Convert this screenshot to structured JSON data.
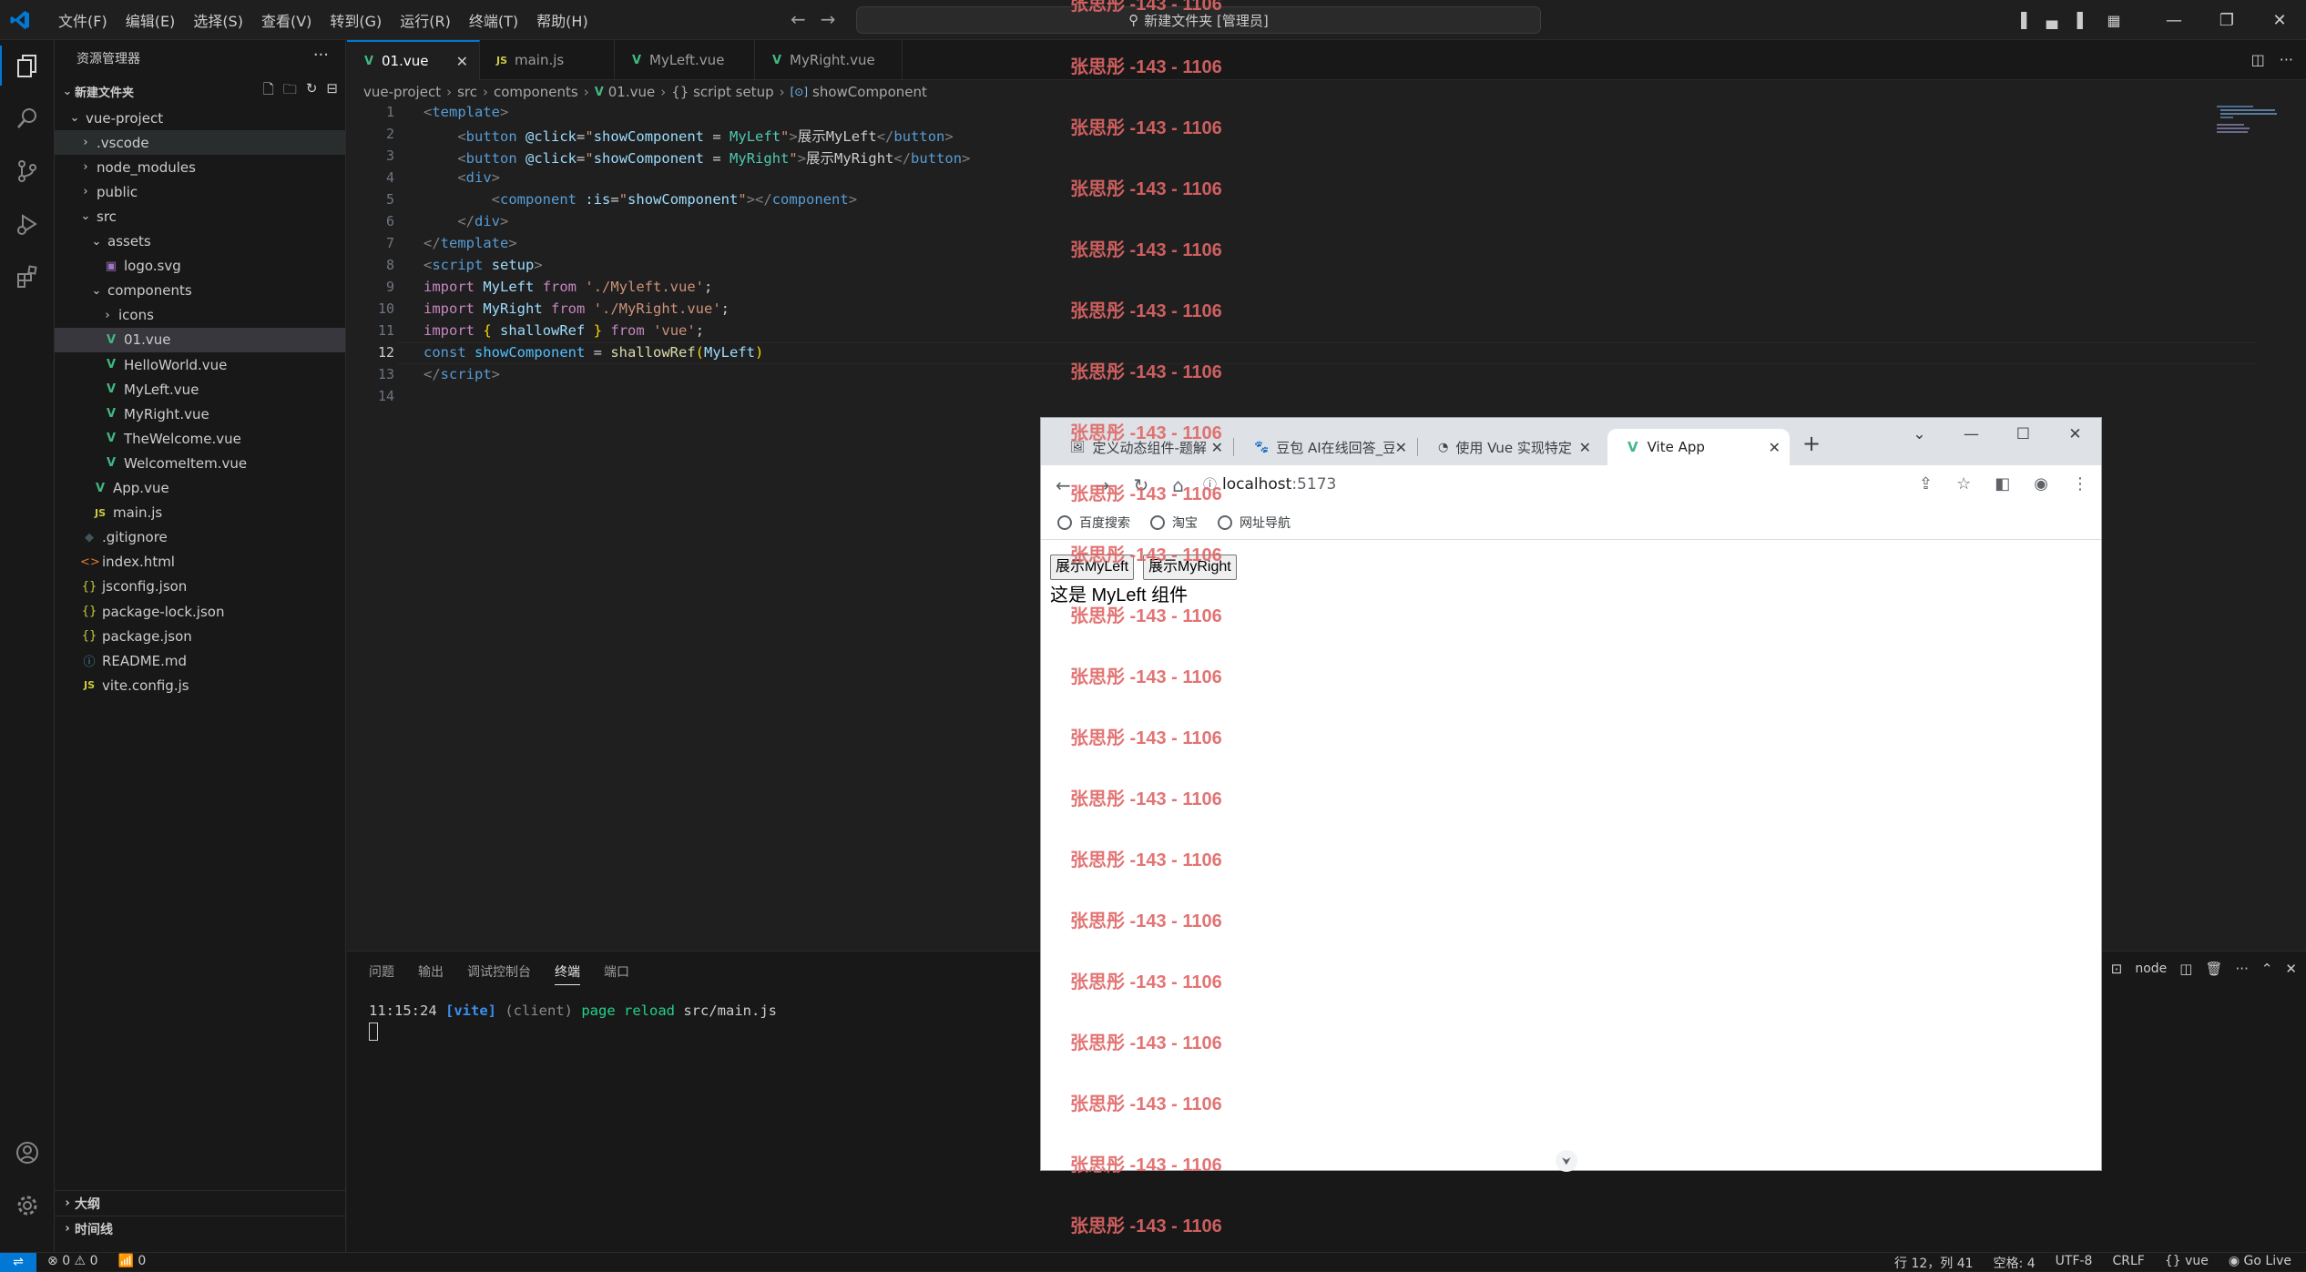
{
  "titlebar": {
    "menus": [
      "文件(F)",
      "编辑(E)",
      "选择(S)",
      "查看(V)",
      "转到(G)",
      "运行(R)",
      "终端(T)",
      "帮助(H)"
    ],
    "search_text": "新建文件夹 [管理员]"
  },
  "sidebar": {
    "header": "资源管理器",
    "section": "新建文件夹",
    "tree": [
      {
        "label": "vue-project",
        "kind": "folder-open",
        "depth": 0
      },
      {
        "label": ".vscode",
        "kind": "folder",
        "depth": 1
      },
      {
        "label": "node_modules",
        "kind": "folder",
        "depth": 1
      },
      {
        "label": "public",
        "kind": "folder",
        "depth": 1
      },
      {
        "label": "src",
        "kind": "folder-open",
        "depth": 1
      },
      {
        "label": "assets",
        "kind": "folder-open",
        "depth": 2
      },
      {
        "label": "logo.svg",
        "kind": "svg",
        "depth": 3
      },
      {
        "label": "components",
        "kind": "folder-open",
        "depth": 2
      },
      {
        "label": "icons",
        "kind": "folder",
        "depth": 3
      },
      {
        "label": "01.vue",
        "kind": "vue",
        "depth": 3
      },
      {
        "label": "HelloWorld.vue",
        "kind": "vue",
        "depth": 3
      },
      {
        "label": "MyLeft.vue",
        "kind": "vue",
        "depth": 3
      },
      {
        "label": "MyRight.vue",
        "kind": "vue",
        "depth": 3
      },
      {
        "label": "TheWelcome.vue",
        "kind": "vue",
        "depth": 3
      },
      {
        "label": "WelcomeItem.vue",
        "kind": "vue",
        "depth": 3
      },
      {
        "label": "App.vue",
        "kind": "vue",
        "depth": 2
      },
      {
        "label": "main.js",
        "kind": "js",
        "depth": 2
      },
      {
        "label": ".gitignore",
        "kind": "git",
        "depth": 1
      },
      {
        "label": "index.html",
        "kind": "html",
        "depth": 1
      },
      {
        "label": "jsconfig.json",
        "kind": "json",
        "depth": 1
      },
      {
        "label": "package-lock.json",
        "kind": "json",
        "depth": 1
      },
      {
        "label": "package.json",
        "kind": "json",
        "depth": 1
      },
      {
        "label": "README.md",
        "kind": "info",
        "depth": 1
      },
      {
        "label": "vite.config.js",
        "kind": "js",
        "depth": 1
      }
    ],
    "outline": "大纲",
    "timeline": "时间线"
  },
  "tabs": [
    {
      "label": "01.vue",
      "kind": "vue",
      "active": true
    },
    {
      "label": "main.js",
      "kind": "js",
      "active": false
    },
    {
      "label": "MyLeft.vue",
      "kind": "vue",
      "active": false
    },
    {
      "label": "MyRight.vue",
      "kind": "vue",
      "active": false
    }
  ],
  "breadcrumb": [
    "vue-project",
    "src",
    "components",
    "01.vue",
    "{} script setup",
    "showComponent"
  ],
  "editor": {
    "current_line": 12,
    "line_numbers": [
      "1",
      "2",
      "3",
      "4",
      "5",
      "6",
      "7",
      "8",
      "9",
      "10",
      "11",
      "12",
      "13",
      "14"
    ]
  },
  "panel": {
    "tabs": [
      "问题",
      "输出",
      "调试控制台",
      "终端",
      "端口"
    ],
    "active_tab": "终端",
    "terminal_time": "11:15:24",
    "terminal_tag": "[vite]",
    "terminal_client": "(client)",
    "terminal_msg": "page reload",
    "terminal_path": "src/main.js",
    "shell": "node"
  },
  "statusbar": {
    "errors": "0",
    "warnings": "0",
    "ports": "0",
    "position": "行 12，列 41",
    "spaces": "空格: 4",
    "encoding": "UTF-8",
    "eol": "CRLF",
    "language": "vue",
    "golive": "Go Live"
  },
  "browser": {
    "tabs": [
      {
        "label": "定义动态组件-题解",
        "active": false
      },
      {
        "label": "豆包 AI在线回答_豆",
        "active": false
      },
      {
        "label": "使用 Vue 实现特定",
        "active": false
      },
      {
        "label": "Vite App",
        "active": true
      }
    ],
    "url_host": "localhost",
    "url_port": ":5173",
    "bookmarks": [
      "百度搜索",
      "淘宝",
      "网址导航"
    ],
    "page": {
      "button_left": "展示MyLeft",
      "button_right": "展示MyRight",
      "content": "这是 MyLeft 组件"
    }
  },
  "watermark": {
    "text": "张思彤 -143 - 1106",
    "color": "#e06666"
  }
}
